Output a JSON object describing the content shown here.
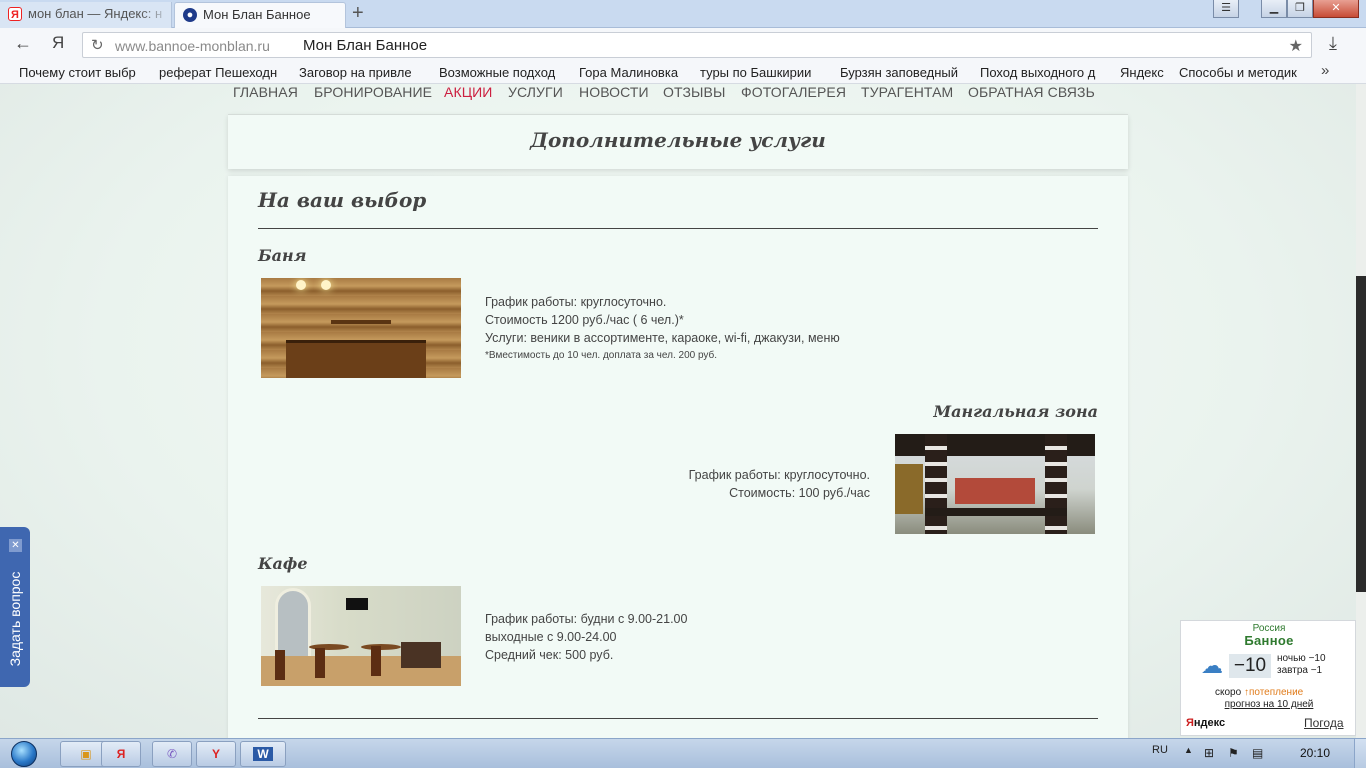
{
  "browser": {
    "tabs": [
      {
        "label": "мон блан — Яндекс: н",
        "favicon": "Я"
      },
      {
        "label": "Мон Блан Банное",
        "favicon": "●"
      }
    ],
    "new_tab": "+",
    "address": {
      "domain": "www.bannoe-monblan.ru",
      "title": "Мон Блан Банное",
      "back": "←",
      "yandex": "Я",
      "reload": "↻",
      "star": "★",
      "download": "⤓"
    },
    "window_controls": {
      "menu": "☰",
      "minimize": "▁",
      "maximize": "❐",
      "close": "✕"
    },
    "bookmarks": [
      "Почему стоит выбр",
      "реферат Пешеходн",
      "Заговор на привле",
      "Возможные подход",
      "Гора Малиновка",
      "туры по Башкирии",
      "Бурзян заповедный",
      "Поход выходного д",
      "Яндекс",
      "Способы и методик"
    ],
    "bookmarks_more": "»"
  },
  "site": {
    "nav": [
      {
        "label": "ГЛАВНАЯ",
        "active": false
      },
      {
        "label": "БРОНИРОВАНИЕ",
        "active": false
      },
      {
        "label": "АКЦИИ",
        "active": true
      },
      {
        "label": "УСЛУГИ",
        "active": false
      },
      {
        "label": "НОВОСТИ",
        "active": false
      },
      {
        "label": "ОТЗЫВЫ",
        "active": false
      },
      {
        "label": "ФОТОГАЛЕРЕЯ",
        "active": false
      },
      {
        "label": "ТУРАГЕНТАМ",
        "active": false
      },
      {
        "label": "ОБРАТНАЯ СВЯЗЬ",
        "active": false
      }
    ],
    "header_title": "Дополнительные услуги",
    "section_title": "На ваш выбор",
    "services": {
      "banya": {
        "title": "Баня",
        "lines": [
          "График работы: круглосуточно.",
          "Стоимость 1200 руб./час ( 6 чел.)*",
          "Услуги: веники в ассортименте, караоке, wi-fi, джакузи, меню"
        ],
        "note": "*Вместимость до 10 чел. доплата за чел. 200 руб."
      },
      "mangal": {
        "title": "Мангальная зона",
        "lines": [
          "График работы: круглосуточно.",
          "Стоимость: 100 руб./час"
        ]
      },
      "cafe": {
        "title": "Кафе",
        "lines": [
          "График работы: будни с  9.00-21.00",
          "выходные с  9.00-24.00",
          "Средний чек: 500 руб."
        ]
      }
    }
  },
  "ask_widget": {
    "label": "Задать вопрос",
    "close": "✕"
  },
  "weather": {
    "region": "Россия",
    "city": "Банное",
    "temp": "−10",
    "night": "ночью  −10",
    "tomorrow": "завтра −1",
    "soon": "скоро",
    "soon_trend": "↑потепление",
    "forecast": "прогноз на 10 дней",
    "brand_first": "Я",
    "brand_rest": "ндекс",
    "pogoda": "Погода",
    "icon": "cloud-icon"
  },
  "taskbar": {
    "lang": "RU",
    "clock": "20:10",
    "tray_up": "▲"
  },
  "colors": {
    "accent": "#cc1f40",
    "text": "#444444",
    "weather_green": "#2f7a2f"
  }
}
